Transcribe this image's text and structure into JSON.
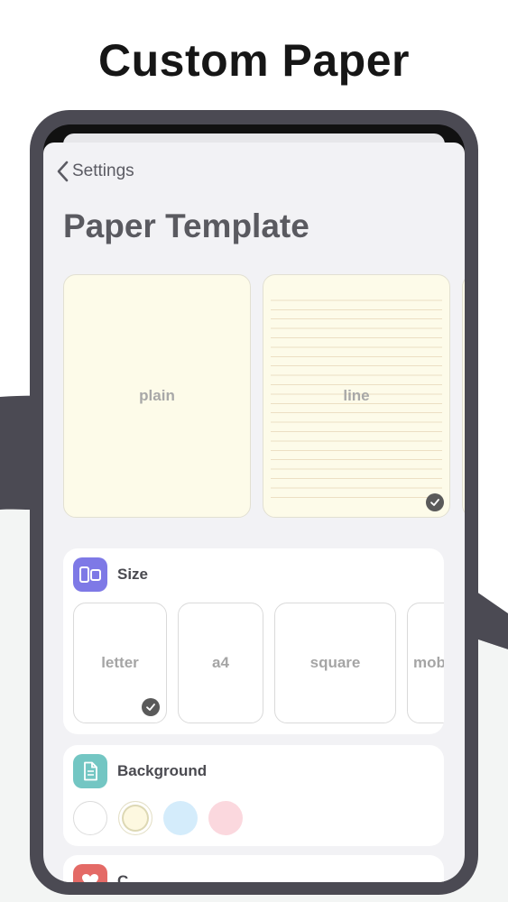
{
  "headline": "Custom Paper",
  "nav": {
    "back_label": "Settings"
  },
  "page_title": "Paper Template",
  "templates": [
    {
      "label": "plain",
      "selected": false,
      "style": "plain"
    },
    {
      "label": "line",
      "selected": true,
      "style": "lined"
    }
  ],
  "size_section": {
    "title": "Size",
    "icon": "layout-icon",
    "options": [
      {
        "label": "letter",
        "selected": true
      },
      {
        "label": "a4",
        "selected": false
      },
      {
        "label": "square",
        "selected": false
      },
      {
        "label": "mob",
        "selected": false
      }
    ]
  },
  "background_section": {
    "title": "Background",
    "icon": "document-icon",
    "colors": [
      "#ffffff",
      "#fdf8e0",
      "#d4ecfb",
      "#fbd8de"
    ],
    "selected_index": 1
  },
  "third_section": {
    "title": "C",
    "icon": "heart-icon"
  },
  "colors": {
    "accent_purple": "#7e79e6",
    "accent_teal": "#73c6c3",
    "accent_red": "#e46a66",
    "paper_cream": "#fdfbe9",
    "device_frame": "#4b4a53"
  }
}
